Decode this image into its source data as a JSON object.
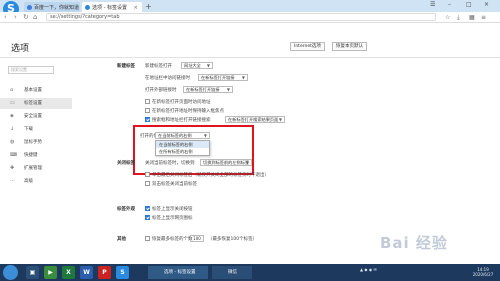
{
  "browser": {
    "tabs": [
      {
        "label": "百度一下，你就知道"
      },
      {
        "label": "选项 - 标签设置"
      }
    ],
    "url": "se://settings/?category=tab"
  },
  "page": {
    "title": "选项",
    "internet_options": "Internet选项",
    "restore_defaults": "恢复本页默认"
  },
  "sidebar": {
    "search_placeholder": "搜索设置",
    "items": [
      {
        "label": "基本设置",
        "icon": "home-icon"
      },
      {
        "label": "标签设置",
        "icon": "tab-icon"
      },
      {
        "label": "安全设置",
        "icon": "shield-icon"
      },
      {
        "label": "下载",
        "icon": "download-icon"
      },
      {
        "label": "鼠标手势",
        "icon": "mouse-icon"
      },
      {
        "label": "快捷键",
        "icon": "keyboard-icon"
      },
      {
        "label": "扩展管理",
        "icon": "puzzle-icon"
      },
      {
        "label": "高级",
        "icon": "more-icon"
      }
    ]
  },
  "sections": {
    "new_tab": {
      "label": "新建标签",
      "new_tab_prefix": "新建标签打开",
      "new_tab_value": "网址大全",
      "address_prefix": "在地址栏中访问链接时",
      "address_value": "在新标签打开链接",
      "open_in_prefix": "打开外部链接时",
      "open_in_value": "在新标签打开链接",
      "cb1": "在新标签打开页面时访问地址",
      "cb2": "在新标签打开地址时保持输入框焦点",
      "cb3": "搜索框和地址栏打开链接搜索",
      "cb3_value": "在新标签打开搜索结果页面",
      "open_pos_label": "打开的位置",
      "open_pos_value": "在当前标签的右侧",
      "popup_options": [
        "在当前标签的右侧",
        "在所有标签的右侧"
      ]
    },
    "close_tab": {
      "label": "关闭标签",
      "closed_prefix": "关闭当前标签时，切换到",
      "closed_value": "切换到标签前的左侧标签",
      "cb1": "单击最后关闭标签后（就仅开关闭全部的标签页时不退出）",
      "cb2": "双击标签关闭当前标签"
    },
    "tab_view": {
      "label": "标签外观",
      "cb1": "标签上显示关闭按钮",
      "cb2": "标签上显示网页图标"
    },
    "other": {
      "label": "其他",
      "cb1": "恢复最多标签的个数",
      "count": "100",
      "note": "（最多恢复100个标签）"
    }
  },
  "watermark": "Bai 经验",
  "taskbar": {
    "task_label": "选项 - 标签设置",
    "task2_label": "微信",
    "time": "14:19",
    "date": "2020/6/27"
  }
}
